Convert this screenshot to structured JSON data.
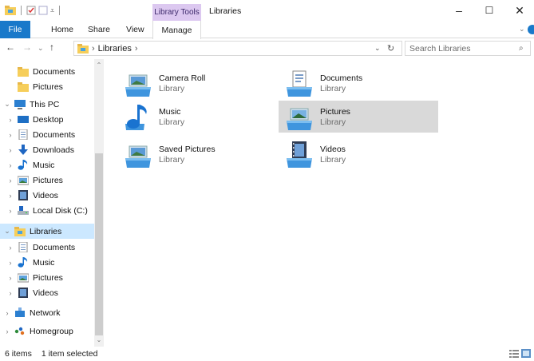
{
  "window": {
    "title": "Libraries",
    "context_tab": "Library Tools",
    "buttons": {
      "minimize": "–",
      "maximize": "☐",
      "close": "✕"
    }
  },
  "ribbon": {
    "tabs": [
      "File",
      "Home",
      "Share",
      "View",
      "Manage"
    ]
  },
  "address": {
    "path": "Libraries",
    "search_placeholder": "Search Libraries"
  },
  "nav": {
    "items": [
      {
        "label": "Documents",
        "icon": "folder-icon",
        "indent": 1,
        "chevron": ""
      },
      {
        "label": "Pictures",
        "icon": "folder-icon",
        "indent": 1,
        "chevron": ""
      },
      {
        "label": "This PC",
        "icon": "computer-icon",
        "indent": 0,
        "chevron": "⌄"
      },
      {
        "label": "Desktop",
        "icon": "desktop-icon",
        "indent": 1,
        "chevron": "›"
      },
      {
        "label": "Documents",
        "icon": "documents-icon",
        "indent": 1,
        "chevron": "›"
      },
      {
        "label": "Downloads",
        "icon": "download-icon",
        "indent": 1,
        "chevron": "›"
      },
      {
        "label": "Music",
        "icon": "music-icon",
        "indent": 1,
        "chevron": "›"
      },
      {
        "label": "Pictures",
        "icon": "pictures-icon",
        "indent": 1,
        "chevron": "›"
      },
      {
        "label": "Videos",
        "icon": "videos-icon",
        "indent": 1,
        "chevron": "›"
      },
      {
        "label": "Local Disk (C:)",
        "icon": "disk-icon",
        "indent": 1,
        "chevron": "›"
      },
      {
        "label": "Libraries",
        "icon": "libraries-icon",
        "indent": 0,
        "chevron": "⌄",
        "selected": true
      },
      {
        "label": "Documents",
        "icon": "documents-icon",
        "indent": 1,
        "chevron": "›"
      },
      {
        "label": "Music",
        "icon": "music-icon",
        "indent": 1,
        "chevron": "›"
      },
      {
        "label": "Pictures",
        "icon": "pictures-icon",
        "indent": 1,
        "chevron": "›"
      },
      {
        "label": "Videos",
        "icon": "videos-icon",
        "indent": 1,
        "chevron": "›"
      },
      {
        "label": "Network",
        "icon": "network-icon",
        "indent": 0,
        "chevron": "›"
      },
      {
        "label": "Homegroup",
        "icon": "homegroup-icon",
        "indent": 0,
        "chevron": "›"
      }
    ]
  },
  "libraries": [
    {
      "name": "Camera Roll",
      "type": "Library",
      "icon": "camera-roll-library-icon"
    },
    {
      "name": "Documents",
      "type": "Library",
      "icon": "documents-library-icon"
    },
    {
      "name": "Music",
      "type": "Library",
      "icon": "music-library-icon"
    },
    {
      "name": "Pictures",
      "type": "Library",
      "icon": "pictures-library-icon",
      "selected": true
    },
    {
      "name": "Saved Pictures",
      "type": "Library",
      "icon": "saved-pictures-library-icon"
    },
    {
      "name": "Videos",
      "type": "Library",
      "icon": "videos-library-icon"
    }
  ],
  "status": {
    "count": "6 items",
    "selection": "1 item selected"
  },
  "colors": {
    "accent": "#1979ca",
    "context_tab": "#dcc8f0",
    "nav_selected": "#cce8ff",
    "item_selected": "#d9d9d9"
  }
}
